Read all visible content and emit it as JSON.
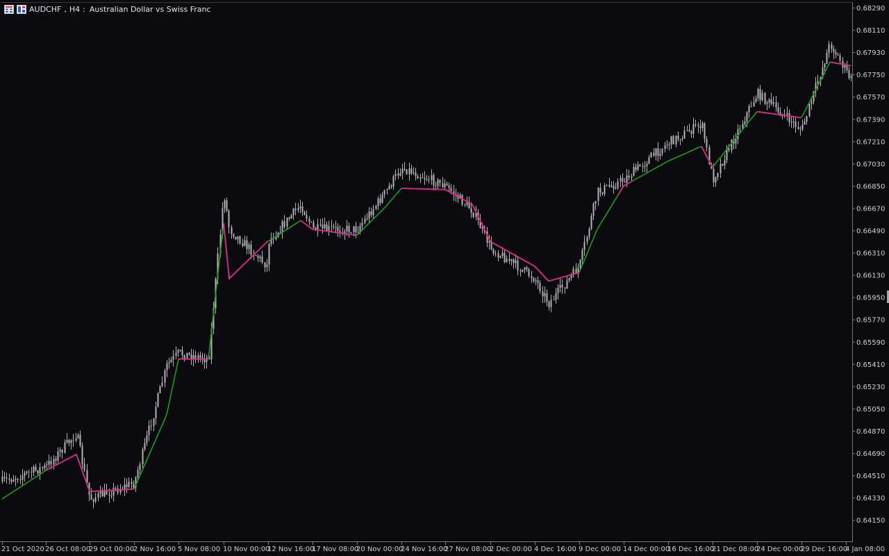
{
  "header": {
    "symbol": "AUDCHF",
    "timeframe": "H4",
    "description": "Australian Dollar vs Swiss  Franc",
    "icons": [
      "menu-grid-icon",
      "expert-advisor-icon"
    ]
  },
  "colors": {
    "background": "#0b0b0f",
    "candle": "#b4b4b4",
    "ma_up": "#1e9e1e",
    "ma_down": "#e0288c",
    "axis": "#7a7a7a",
    "text": "#d8d8d8"
  },
  "price_axis": {
    "labels": [
      "0.68290",
      "0.68110",
      "0.67930",
      "0.67750",
      "0.67570",
      "0.67390",
      "0.67210",
      "0.67030",
      "0.66850",
      "0.66670",
      "0.66490",
      "0.66310",
      "0.66130",
      "0.65950",
      "0.65770",
      "0.65590",
      "0.65410",
      "0.65230",
      "0.65050",
      "0.64870",
      "0.64690",
      "0.64510",
      "0.64330",
      "0.64150"
    ],
    "top_value": 0.6829,
    "bottom_value": 0.6415
  },
  "time_axis": {
    "labels": [
      "21 Oct 2020",
      "26 Oct 08:00",
      "29 Oct 00:00",
      "2 Nov 16:00",
      "5 Nov 08:00",
      "10 Nov 00:00",
      "12 Nov 16:00",
      "17 Nov 08:00",
      "20 Nov 00:00",
      "24 Nov 16:00",
      "27 Nov 08:00",
      "2 Dec 00:00",
      "4 Dec 16:00",
      "9 Dec 00:00",
      "14 Dec 00:00",
      "16 Dec 16:00",
      "21 Dec 08:00",
      "24 Dec 00:00",
      "29 Dec 16:00",
      "4 Jan 08:00"
    ]
  },
  "chart_data": {
    "type": "line",
    "title": "AUDCHF, H4:  Australian Dollar vs Swiss  Franc",
    "xlabel": "",
    "ylabel": "",
    "ylim": [
      0.6405,
      0.6835
    ],
    "grid": false,
    "price_path": [
      {
        "x": "21 Oct 2020",
        "y": 0.6446
      },
      {
        "x": "26 Oct 08:00",
        "y": 0.6458
      },
      {
        "x": "27 Oct",
        "y": 0.6485
      },
      {
        "x": "29 Oct 00:00",
        "y": 0.6432
      },
      {
        "x": "2 Nov 16:00",
        "y": 0.6445
      },
      {
        "x": "4 Nov",
        "y": 0.654
      },
      {
        "x": "5 Nov 08:00",
        "y": 0.655
      },
      {
        "x": "6 Nov",
        "y": 0.6545
      },
      {
        "x": "9 Nov",
        "y": 0.665
      },
      {
        "x": "10 Nov 00:00",
        "y": 0.668
      },
      {
        "x": "11 Nov",
        "y": 0.662
      },
      {
        "x": "12 Nov 16:00",
        "y": 0.664
      },
      {
        "x": "16 Nov",
        "y": 0.667
      },
      {
        "x": "17 Nov 08:00",
        "y": 0.665
      },
      {
        "x": "20 Nov 00:00",
        "y": 0.665
      },
      {
        "x": "23 Nov",
        "y": 0.668
      },
      {
        "x": "24 Nov 16:00",
        "y": 0.67
      },
      {
        "x": "27 Nov 08:00",
        "y": 0.6685
      },
      {
        "x": "30 Nov",
        "y": 0.6665
      },
      {
        "x": "2 Dec 00:00",
        "y": 0.6635
      },
      {
        "x": "4 Dec 16:00",
        "y": 0.661
      },
      {
        "x": "7 Dec",
        "y": 0.659
      },
      {
        "x": "9 Dec 00:00",
        "y": 0.662
      },
      {
        "x": "10 Dec",
        "y": 0.668
      },
      {
        "x": "14 Dec 00:00",
        "y": 0.669
      },
      {
        "x": "16 Dec 16:00",
        "y": 0.672
      },
      {
        "x": "17 Dec",
        "y": 0.6735
      },
      {
        "x": "21 Dec 08:00",
        "y": 0.669
      },
      {
        "x": "24 Dec 00:00",
        "y": 0.676
      },
      {
        "x": "29 Dec 16:00",
        "y": 0.673
      },
      {
        "x": "1 Jan",
        "y": 0.68
      },
      {
        "x": "4 Jan 08:00",
        "y": 0.677
      }
    ],
    "ma_path": [
      {
        "x": "21 Oct 2020",
        "y": 0.6432
      },
      {
        "x": "26 Oct 08:00",
        "y": 0.6455
      },
      {
        "x": "27 Oct",
        "y": 0.6468
      },
      {
        "x": "29 Oct 00:00",
        "y": 0.6438
      },
      {
        "x": "2 Nov 16:00",
        "y": 0.644
      },
      {
        "x": "4 Nov",
        "y": 0.65
      },
      {
        "x": "5 Nov 08:00",
        "y": 0.6545
      },
      {
        "x": "6 Nov",
        "y": 0.6545
      },
      {
        "x": "9 Nov",
        "y": 0.661
      },
      {
        "x": "10 Nov 00:00",
        "y": 0.6655
      },
      {
        "x": "11 Nov",
        "y": 0.664
      },
      {
        "x": "12 Nov 16:00",
        "y": 0.664
      },
      {
        "x": "16 Nov",
        "y": 0.6657
      },
      {
        "x": "17 Nov 08:00",
        "y": 0.665
      },
      {
        "x": "20 Nov 00:00",
        "y": 0.6645
      },
      {
        "x": "23 Nov",
        "y": 0.6668
      },
      {
        "x": "24 Nov 16:00",
        "y": 0.6683
      },
      {
        "x": "27 Nov 08:00",
        "y": 0.6682
      },
      {
        "x": "30 Nov",
        "y": 0.667
      },
      {
        "x": "2 Dec 00:00",
        "y": 0.664
      },
      {
        "x": "4 Dec 16:00",
        "y": 0.662
      },
      {
        "x": "7 Dec",
        "y": 0.6608
      },
      {
        "x": "9 Dec 00:00",
        "y": 0.6615
      },
      {
        "x": "10 Dec",
        "y": 0.665
      },
      {
        "x": "14 Dec 00:00",
        "y": 0.6685
      },
      {
        "x": "16 Dec 16:00",
        "y": 0.6705
      },
      {
        "x": "17 Dec",
        "y": 0.6717
      },
      {
        "x": "21 Dec 08:00",
        "y": 0.67
      },
      {
        "x": "24 Dec 00:00",
        "y": 0.6745
      },
      {
        "x": "29 Dec 16:00",
        "y": 0.674
      },
      {
        "x": "1 Jan",
        "y": 0.6785
      },
      {
        "x": "4 Jan 08:00",
        "y": 0.6782
      }
    ],
    "ma_down_segments": [
      [
        "26 Oct 08:00",
        "2 Nov 16:00"
      ],
      [
        "5 Nov 08:00",
        "6 Nov"
      ],
      [
        "10 Nov 00:00",
        "12 Nov 16:00"
      ],
      [
        "16 Nov",
        "20 Nov 00:00"
      ],
      [
        "24 Nov 16:00",
        "9 Dec 00:00"
      ],
      [
        "14 Dec 00:00",
        "14 Dec 00:00"
      ],
      [
        "17 Dec",
        "21 Dec 08:00"
      ],
      [
        "24 Dec 00:00",
        "29 Dec 16:00"
      ],
      [
        "1 Jan",
        "4 Jan 08:00"
      ]
    ]
  }
}
